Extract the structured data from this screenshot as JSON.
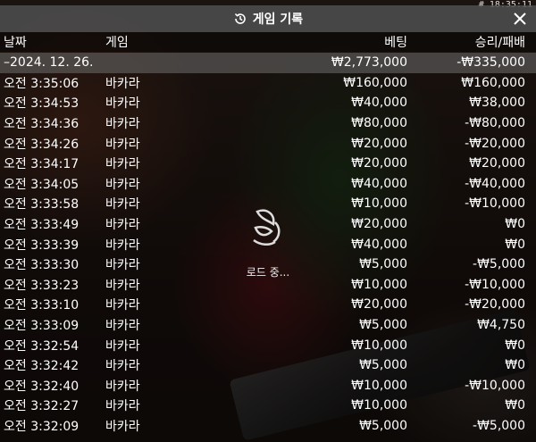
{
  "status": {
    "timestamp": "# 18:35:11"
  },
  "title": "게임 기록",
  "headers": {
    "date": "날짜",
    "game": "게임",
    "bet": "베팅",
    "winloss": "승리/패배"
  },
  "summary": {
    "date": "–2024. 12. 26.",
    "bet": "₩2,773,000",
    "winloss": "-₩335,000"
  },
  "loading_text": "로드 중...",
  "rows": [
    {
      "time": "오전 3:35:06",
      "game": "바카라",
      "bet": "₩160,000",
      "winloss": "₩160,000"
    },
    {
      "time": "오전 3:34:53",
      "game": "바카라",
      "bet": "₩40,000",
      "winloss": "₩38,000"
    },
    {
      "time": "오전 3:34:36",
      "game": "바카라",
      "bet": "₩80,000",
      "winloss": "-₩80,000"
    },
    {
      "time": "오전 3:34:26",
      "game": "바카라",
      "bet": "₩20,000",
      "winloss": "-₩20,000"
    },
    {
      "time": "오전 3:34:17",
      "game": "바카라",
      "bet": "₩20,000",
      "winloss": "₩20,000"
    },
    {
      "time": "오전 3:34:05",
      "game": "바카라",
      "bet": "₩40,000",
      "winloss": "-₩40,000"
    },
    {
      "time": "오전 3:33:58",
      "game": "바카라",
      "bet": "₩10,000",
      "winloss": "-₩10,000"
    },
    {
      "time": "오전 3:33:49",
      "game": "바카라",
      "bet": "₩20,000",
      "winloss": "₩0"
    },
    {
      "time": "오전 3:33:39",
      "game": "바카라",
      "bet": "₩40,000",
      "winloss": "₩0"
    },
    {
      "time": "오전 3:33:30",
      "game": "바카라",
      "bet": "₩5,000",
      "winloss": "-₩5,000"
    },
    {
      "time": "오전 3:33:23",
      "game": "바카라",
      "bet": "₩10,000",
      "winloss": "-₩10,000"
    },
    {
      "time": "오전 3:33:10",
      "game": "바카라",
      "bet": "₩20,000",
      "winloss": "-₩20,000"
    },
    {
      "time": "오전 3:33:09",
      "game": "바카라",
      "bet": "₩5,000",
      "winloss": "₩4,750"
    },
    {
      "time": "오전 3:32:54",
      "game": "바카라",
      "bet": "₩10,000",
      "winloss": "₩0"
    },
    {
      "time": "오전 3:32:42",
      "game": "바카라",
      "bet": "₩5,000",
      "winloss": "₩0"
    },
    {
      "time": "오전 3:32:40",
      "game": "바카라",
      "bet": "₩10,000",
      "winloss": "-₩10,000"
    },
    {
      "time": "오전 3:32:27",
      "game": "바카라",
      "bet": "₩10,000",
      "winloss": "₩0"
    },
    {
      "time": "오전 3:32:09",
      "game": "바카라",
      "bet": "₩5,000",
      "winloss": "-₩5,000"
    }
  ]
}
